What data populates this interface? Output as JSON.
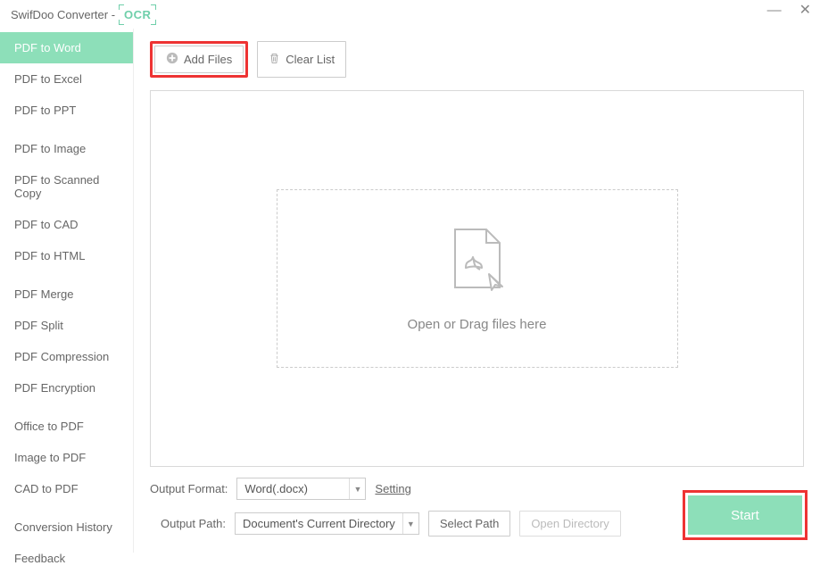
{
  "titlebar": {
    "title": "SwifDoo Converter -",
    "badge": "OCR"
  },
  "sidebar": {
    "group1": [
      "PDF to Word",
      "PDF to Excel",
      "PDF to PPT"
    ],
    "group2": [
      "PDF to Image",
      "PDF to Scanned Copy",
      "PDF to CAD",
      "PDF to HTML"
    ],
    "group3": [
      "PDF Merge",
      "PDF Split",
      "PDF Compression",
      "PDF Encryption"
    ],
    "group4": [
      "Office to PDF",
      "Image to PDF",
      "CAD to PDF"
    ],
    "group5": [
      "Conversion History",
      "Feedback"
    ]
  },
  "toolbar": {
    "add_files": "Add Files",
    "clear_list": "Clear List"
  },
  "drop": {
    "text": "Open or Drag files here"
  },
  "bottom": {
    "format_label": "Output Format:",
    "format_value": "Word(.docx)",
    "setting": "Setting",
    "path_label": "Output Path:",
    "path_value": "Document's Current Directory",
    "select_path": "Select Path",
    "open_dir": "Open Directory"
  },
  "start": {
    "label": "Start"
  }
}
